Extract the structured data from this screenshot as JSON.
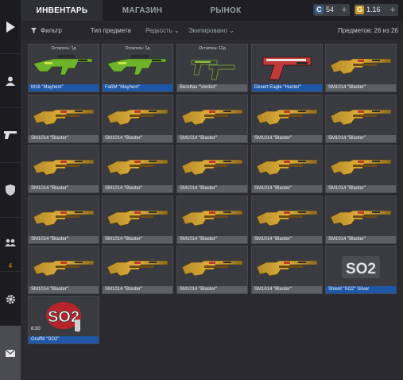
{
  "tabs": [
    "ИНВЕНТАРЬ",
    "МАГАЗИН",
    "РЫНОК"
  ],
  "currency": {
    "silver": {
      "icon": "C",
      "value": "54",
      "color": "#3f5f8a"
    },
    "gold": {
      "icon": "G",
      "value": "1.16",
      "color": "#d19a1f"
    },
    "plus": "+"
  },
  "filters": {
    "filter_label": "Фильтр",
    "type_label": "Тип предмета",
    "rarity_label": "Редкость",
    "equipped_label": "Экипировано",
    "count_text": "Предметов: 26 из 26"
  },
  "sidebar": {
    "counter": "4",
    "icons": [
      "play-icon",
      "profile-icon",
      "pistol-icon",
      "shield-icon",
      "team-icon",
      "gear-icon",
      "mail-icon"
    ]
  },
  "items": [
    {
      "name": "M16 \"Mayhem\"",
      "timer": "Осталось: 1д",
      "blue": true,
      "kind": "rifle-green"
    },
    {
      "name": "FaбM \"Mayhem\"",
      "timer": "Осталось: 1д",
      "blue": true,
      "kind": "rifle-green"
    },
    {
      "name": "Berettas \"Verdict\"",
      "timer": "Осталось: 12д",
      "blue": false,
      "kind": "pistols"
    },
    {
      "name": "Desert Eagle \"Hunter\"",
      "timer": "",
      "blue": true,
      "kind": "deagle"
    },
    {
      "name": "SM1014 \"Blaster\"",
      "timer": "",
      "blue": false,
      "kind": "shotgun"
    },
    {
      "name": "SM1014 \"Blaster\"",
      "timer": "",
      "blue": false,
      "kind": "shotgun"
    },
    {
      "name": "SM1014 \"Blaster\"",
      "timer": "",
      "blue": false,
      "kind": "shotgun"
    },
    {
      "name": "SM1014 \"Blaster\"",
      "timer": "",
      "blue": false,
      "kind": "shotgun"
    },
    {
      "name": "SM1014 \"Blaster\"",
      "timer": "",
      "blue": false,
      "kind": "shotgun"
    },
    {
      "name": "SM1014 \"Blaster\"",
      "timer": "",
      "blue": false,
      "kind": "shotgun"
    },
    {
      "name": "SM1014 \"Blaster\"",
      "timer": "",
      "blue": false,
      "kind": "shotgun"
    },
    {
      "name": "SM1014 \"Blaster\"",
      "timer": "",
      "blue": false,
      "kind": "shotgun"
    },
    {
      "name": "SM1014 \"Blaster\"",
      "timer": "",
      "blue": false,
      "kind": "shotgun"
    },
    {
      "name": "SM1014 \"Blaster\"",
      "timer": "",
      "blue": false,
      "kind": "shotgun"
    },
    {
      "name": "SM1014 \"Blaster\"",
      "timer": "",
      "blue": false,
      "kind": "shotgun"
    },
    {
      "name": "SM1014 \"Blaster\"",
      "timer": "",
      "blue": false,
      "kind": "shotgun"
    },
    {
      "name": "SM1014 \"Blaster\"",
      "timer": "",
      "blue": false,
      "kind": "shotgun"
    },
    {
      "name": "SM1014 \"Blaster\"",
      "timer": "",
      "blue": false,
      "kind": "shotgun"
    },
    {
      "name": "SM1014 \"Blaster\"",
      "timer": "",
      "blue": false,
      "kind": "shotgun"
    },
    {
      "name": "SM1014 \"Blaster\"",
      "timer": "",
      "blue": false,
      "kind": "shotgun"
    },
    {
      "name": "SM1014 \"Blaster\"",
      "timer": "",
      "blue": false,
      "kind": "shotgun"
    },
    {
      "name": "SM1014 \"Blaster\"",
      "timer": "",
      "blue": false,
      "kind": "shotgun"
    },
    {
      "name": "SM1014 \"Blaster\"",
      "timer": "",
      "blue": false,
      "kind": "shotgun"
    },
    {
      "name": "SM1014 \"Blaster\"",
      "timer": "",
      "blue": false,
      "kind": "shotgun"
    },
    {
      "name": "Shield \"SO2\" Silver",
      "timer": "",
      "blue": true,
      "kind": "shield"
    },
    {
      "name": "Graffiti \"SO2\"",
      "timer": "",
      "blue": true,
      "kind": "graffiti",
      "badge": "8:30"
    }
  ]
}
